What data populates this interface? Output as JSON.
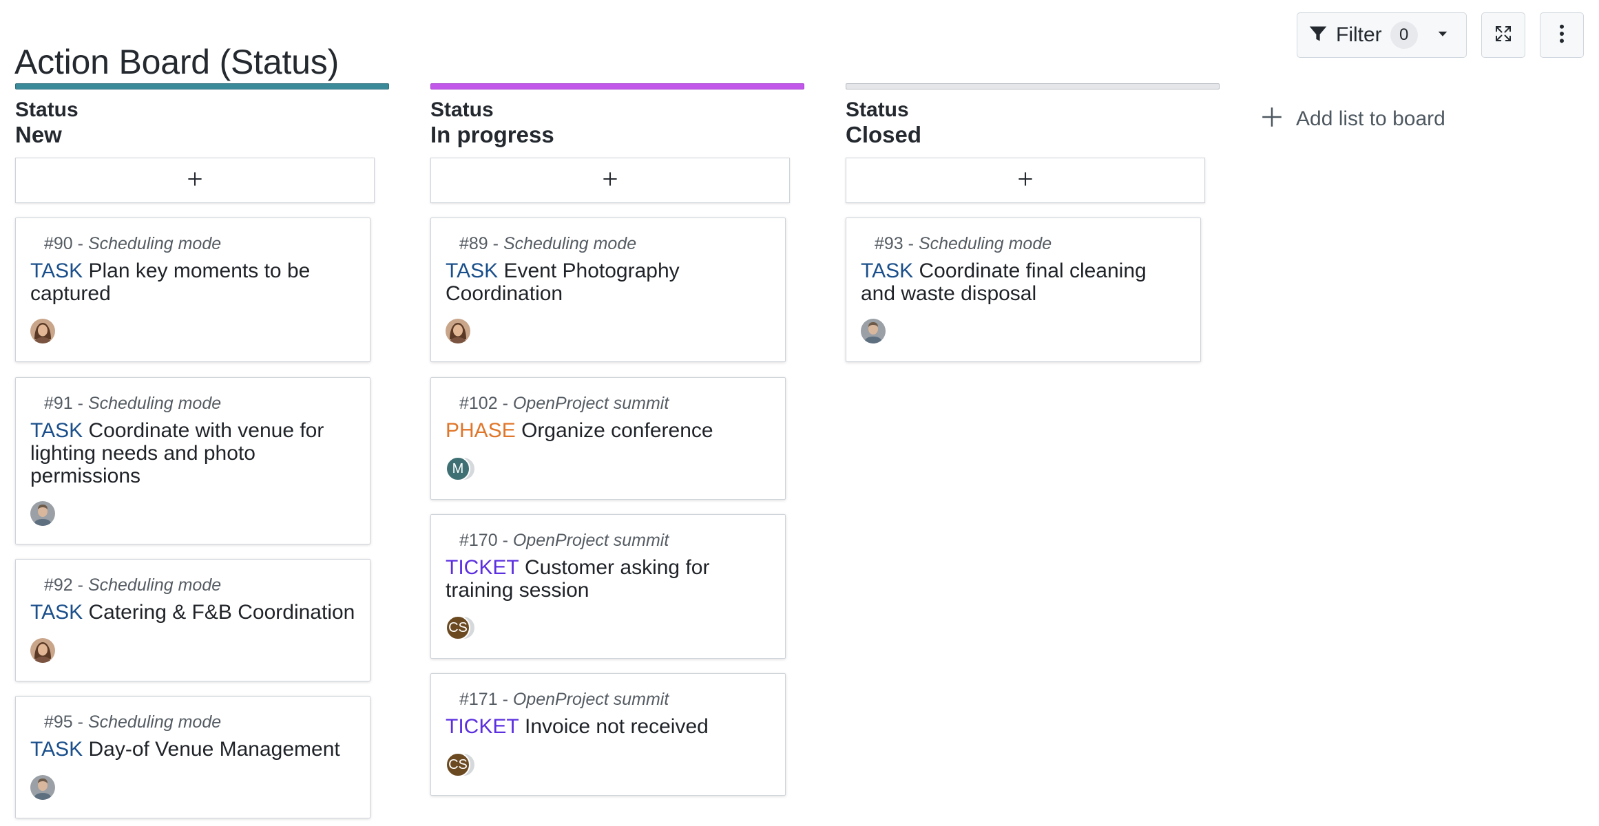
{
  "page": {
    "title": "Action Board (Status)"
  },
  "toolbar": {
    "filter_label": "Filter",
    "filter_count": "0",
    "icons": [
      "filter-icon",
      "chevron-down-icon",
      "fullscreen-icon",
      "kebab-menu-icon"
    ]
  },
  "colors": {
    "new": "#3b8a9a",
    "in_progress": "#c258ea",
    "closed": "#dfe1e4",
    "task": "#1a4f8b",
    "phase": "#e0762a",
    "ticket": "#5b2fe0"
  },
  "columns": [
    {
      "attribute": "Status",
      "name": "New",
      "add_icon": "plus-icon",
      "cards": [
        {
          "id": "#90",
          "separator": " - ",
          "project": "Scheduling mode",
          "type": "TASK",
          "subject": "Plan key moments to be captured",
          "assignee": {
            "kind": "photo",
            "style": "woman"
          }
        },
        {
          "id": "#91",
          "separator": " - ",
          "project": "Scheduling mode",
          "type": "TASK",
          "subject": "Coordinate with venue for lighting needs and photo permissions",
          "assignee": {
            "kind": "photo",
            "style": "man"
          }
        },
        {
          "id": "#92",
          "separator": " - ",
          "project": "Scheduling mode",
          "type": "TASK",
          "subject": "Catering & F&B Coordination",
          "assignee": {
            "kind": "photo",
            "style": "woman"
          }
        },
        {
          "id": "#95",
          "separator": " - ",
          "project": "Scheduling mode",
          "type": "TASK",
          "subject": "Day-of Venue Management",
          "assignee": {
            "kind": "photo",
            "style": "man"
          }
        }
      ]
    },
    {
      "attribute": "Status",
      "name": "In progress",
      "add_icon": "plus-icon",
      "cards": [
        {
          "id": "#89",
          "separator": " - ",
          "project": "Scheduling mode",
          "type": "TASK",
          "subject": " Event Photography Coordination",
          "assignee": {
            "kind": "photo",
            "style": "woman"
          }
        },
        {
          "id": "#102",
          "separator": " - ",
          "project": "OpenProject summit",
          "type": "PHASE",
          "subject": "Organize conference",
          "assignee": {
            "kind": "initials",
            "initials": "M",
            "color": "#3d6f73"
          }
        },
        {
          "id": "#170",
          "separator": " - ",
          "project": "OpenProject summit",
          "type": "TICKET",
          "subject": "Customer asking for training session",
          "assignee": {
            "kind": "initials",
            "initials": "CS",
            "color": "#6b4a22"
          }
        },
        {
          "id": "#171",
          "separator": " - ",
          "project": "OpenProject summit",
          "type": "TICKET",
          "subject": "Invoice not received",
          "assignee": {
            "kind": "initials",
            "initials": "CS",
            "color": "#6b4a22"
          }
        }
      ]
    },
    {
      "attribute": "Status",
      "name": "Closed",
      "add_icon": "plus-icon",
      "cards": [
        {
          "id": "#93",
          "separator": " - ",
          "project": "Scheduling mode",
          "type": "TASK",
          "subject": "Coordinate final cleaning and waste disposal",
          "assignee": {
            "kind": "photo",
            "style": "man"
          }
        }
      ]
    }
  ],
  "add_list": {
    "label": "Add list to board",
    "icon": "plus-icon"
  }
}
